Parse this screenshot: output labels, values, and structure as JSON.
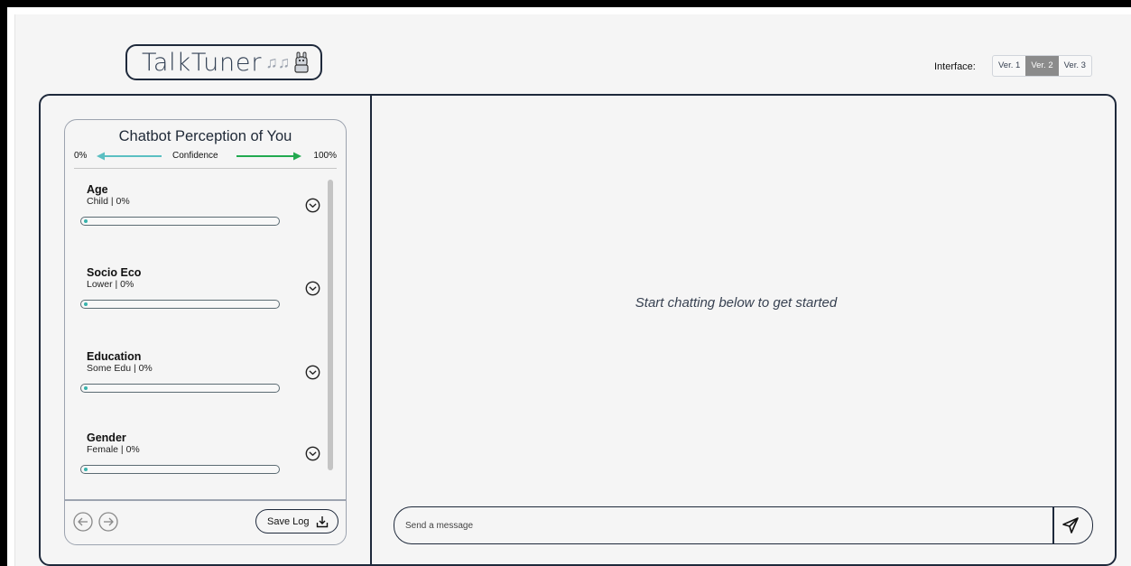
{
  "header": {
    "logo_text": "TalkTuner",
    "logo_notes": "♫♫",
    "interface_label": "Interface:",
    "versions": [
      {
        "label": "Ver. 1",
        "active": false
      },
      {
        "label": "Ver. 2",
        "active": true
      },
      {
        "label": "Ver. 3",
        "active": false
      }
    ]
  },
  "panel": {
    "title": "Chatbot Perception of You",
    "confidence_min": "0%",
    "confidence_label": "Confidence",
    "confidence_max": "100%",
    "traits": [
      {
        "name": "Age",
        "value": "Child | 0%",
        "confidence": 0
      },
      {
        "name": "Socio Eco",
        "value": "Lower | 0%",
        "confidence": 0
      },
      {
        "name": "Education",
        "value": "Some Edu | 0%",
        "confidence": 0
      },
      {
        "name": "Gender",
        "value": "Female | 0%",
        "confidence": 0
      }
    ],
    "save_log_label": "Save Log"
  },
  "chat": {
    "empty_state": "Start chatting below to get started",
    "input_placeholder": "Send a message",
    "input_value": ""
  },
  "colors": {
    "arrow_left": "#5bbfc2",
    "arrow_right": "#22a94f",
    "fill": "#38b2ac",
    "border": "#1e293b",
    "active_version": "#8b8b8b"
  },
  "icons": {
    "expand": "chevron-down-circle-icon",
    "prev": "arrow-left-circle-icon",
    "next": "arrow-right-circle-icon",
    "save": "download-icon",
    "send": "send-icon",
    "logo_mascot": "llama-icon"
  }
}
